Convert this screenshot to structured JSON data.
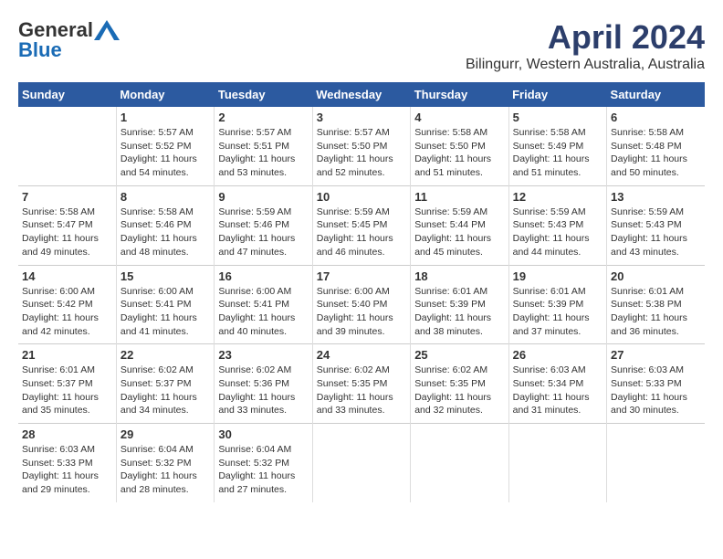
{
  "header": {
    "logo_general": "General",
    "logo_blue": "Blue",
    "month": "April 2024",
    "location": "Bilingurr, Western Australia, Australia"
  },
  "days_of_week": [
    "Sunday",
    "Monday",
    "Tuesday",
    "Wednesday",
    "Thursday",
    "Friday",
    "Saturday"
  ],
  "weeks": [
    [
      {
        "day": "",
        "info": ""
      },
      {
        "day": "1",
        "info": "Sunrise: 5:57 AM\nSunset: 5:52 PM\nDaylight: 11 hours\nand 54 minutes."
      },
      {
        "day": "2",
        "info": "Sunrise: 5:57 AM\nSunset: 5:51 PM\nDaylight: 11 hours\nand 53 minutes."
      },
      {
        "day": "3",
        "info": "Sunrise: 5:57 AM\nSunset: 5:50 PM\nDaylight: 11 hours\nand 52 minutes."
      },
      {
        "day": "4",
        "info": "Sunrise: 5:58 AM\nSunset: 5:50 PM\nDaylight: 11 hours\nand 51 minutes."
      },
      {
        "day": "5",
        "info": "Sunrise: 5:58 AM\nSunset: 5:49 PM\nDaylight: 11 hours\nand 51 minutes."
      },
      {
        "day": "6",
        "info": "Sunrise: 5:58 AM\nSunset: 5:48 PM\nDaylight: 11 hours\nand 50 minutes."
      }
    ],
    [
      {
        "day": "7",
        "info": "Sunrise: 5:58 AM\nSunset: 5:47 PM\nDaylight: 11 hours\nand 49 minutes."
      },
      {
        "day": "8",
        "info": "Sunrise: 5:58 AM\nSunset: 5:46 PM\nDaylight: 11 hours\nand 48 minutes."
      },
      {
        "day": "9",
        "info": "Sunrise: 5:59 AM\nSunset: 5:46 PM\nDaylight: 11 hours\nand 47 minutes."
      },
      {
        "day": "10",
        "info": "Sunrise: 5:59 AM\nSunset: 5:45 PM\nDaylight: 11 hours\nand 46 minutes."
      },
      {
        "day": "11",
        "info": "Sunrise: 5:59 AM\nSunset: 5:44 PM\nDaylight: 11 hours\nand 45 minutes."
      },
      {
        "day": "12",
        "info": "Sunrise: 5:59 AM\nSunset: 5:43 PM\nDaylight: 11 hours\nand 44 minutes."
      },
      {
        "day": "13",
        "info": "Sunrise: 5:59 AM\nSunset: 5:43 PM\nDaylight: 11 hours\nand 43 minutes."
      }
    ],
    [
      {
        "day": "14",
        "info": "Sunrise: 6:00 AM\nSunset: 5:42 PM\nDaylight: 11 hours\nand 42 minutes."
      },
      {
        "day": "15",
        "info": "Sunrise: 6:00 AM\nSunset: 5:41 PM\nDaylight: 11 hours\nand 41 minutes."
      },
      {
        "day": "16",
        "info": "Sunrise: 6:00 AM\nSunset: 5:41 PM\nDaylight: 11 hours\nand 40 minutes."
      },
      {
        "day": "17",
        "info": "Sunrise: 6:00 AM\nSunset: 5:40 PM\nDaylight: 11 hours\nand 39 minutes."
      },
      {
        "day": "18",
        "info": "Sunrise: 6:01 AM\nSunset: 5:39 PM\nDaylight: 11 hours\nand 38 minutes."
      },
      {
        "day": "19",
        "info": "Sunrise: 6:01 AM\nSunset: 5:39 PM\nDaylight: 11 hours\nand 37 minutes."
      },
      {
        "day": "20",
        "info": "Sunrise: 6:01 AM\nSunset: 5:38 PM\nDaylight: 11 hours\nand 36 minutes."
      }
    ],
    [
      {
        "day": "21",
        "info": "Sunrise: 6:01 AM\nSunset: 5:37 PM\nDaylight: 11 hours\nand 35 minutes."
      },
      {
        "day": "22",
        "info": "Sunrise: 6:02 AM\nSunset: 5:37 PM\nDaylight: 11 hours\nand 34 minutes."
      },
      {
        "day": "23",
        "info": "Sunrise: 6:02 AM\nSunset: 5:36 PM\nDaylight: 11 hours\nand 33 minutes."
      },
      {
        "day": "24",
        "info": "Sunrise: 6:02 AM\nSunset: 5:35 PM\nDaylight: 11 hours\nand 33 minutes."
      },
      {
        "day": "25",
        "info": "Sunrise: 6:02 AM\nSunset: 5:35 PM\nDaylight: 11 hours\nand 32 minutes."
      },
      {
        "day": "26",
        "info": "Sunrise: 6:03 AM\nSunset: 5:34 PM\nDaylight: 11 hours\nand 31 minutes."
      },
      {
        "day": "27",
        "info": "Sunrise: 6:03 AM\nSunset: 5:33 PM\nDaylight: 11 hours\nand 30 minutes."
      }
    ],
    [
      {
        "day": "28",
        "info": "Sunrise: 6:03 AM\nSunset: 5:33 PM\nDaylight: 11 hours\nand 29 minutes."
      },
      {
        "day": "29",
        "info": "Sunrise: 6:04 AM\nSunset: 5:32 PM\nDaylight: 11 hours\nand 28 minutes."
      },
      {
        "day": "30",
        "info": "Sunrise: 6:04 AM\nSunset: 5:32 PM\nDaylight: 11 hours\nand 27 minutes."
      },
      {
        "day": "",
        "info": ""
      },
      {
        "day": "",
        "info": ""
      },
      {
        "day": "",
        "info": ""
      },
      {
        "day": "",
        "info": ""
      }
    ]
  ]
}
